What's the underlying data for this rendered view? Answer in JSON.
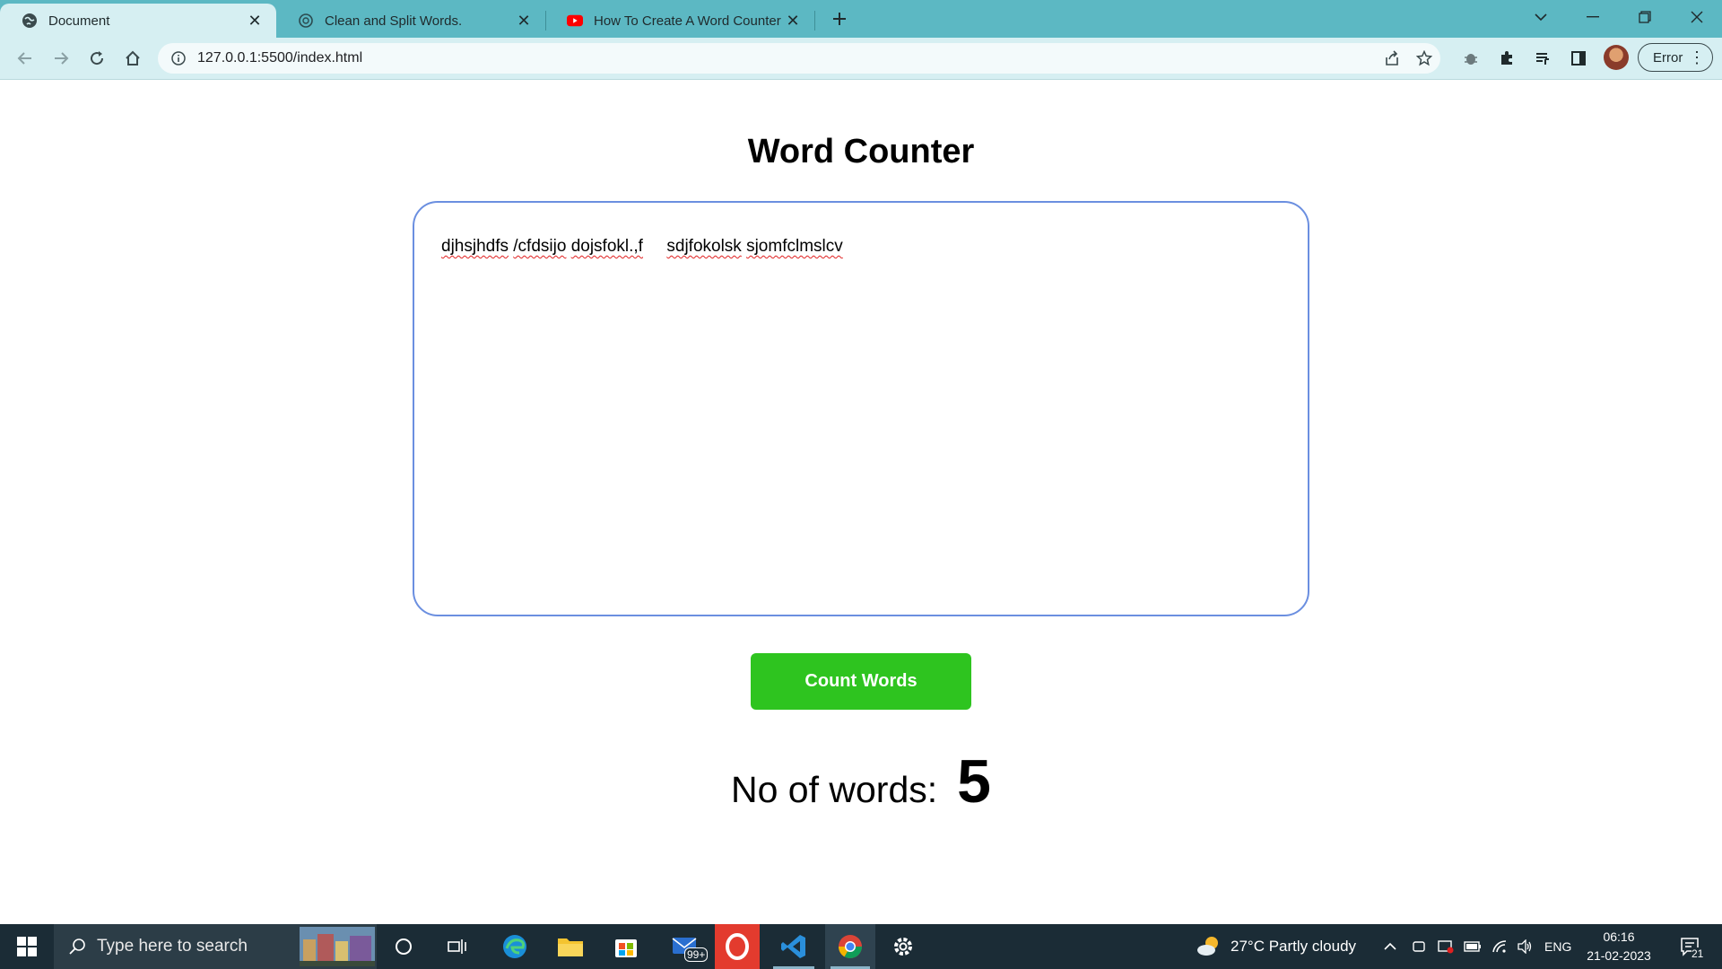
{
  "browser": {
    "tabs": [
      {
        "title": "Document",
        "favicon": "globe-icon",
        "active": true
      },
      {
        "title": "Clean and Split Words.",
        "favicon": "openai-icon",
        "active": false
      },
      {
        "title": "How To Create A Word Counter U",
        "favicon": "youtube-icon",
        "active": false
      }
    ],
    "address": "127.0.0.1:5500/index.html",
    "profile_button": "Error"
  },
  "page": {
    "title": "Word Counter",
    "textarea_words": [
      "djhsjhdfs",
      "/cfdsijo",
      "dojsfokl.,f",
      "sdjfokolsk",
      "sjomfclmslcv"
    ],
    "button_label": "Count Words",
    "result_label": "No of words:",
    "result_value": "5"
  },
  "taskbar": {
    "search_placeholder": "Type here to search",
    "mail_badge": "99+",
    "weather": "27°C  Partly cloudy",
    "language": "ENG",
    "time": "06:16",
    "date": "21-02-2023",
    "notification_count": "21"
  },
  "colors": {
    "tabstrip": "#5cb8c3",
    "toolbar": "#d6eff2",
    "button": "#2ec41f",
    "textarea_border": "#6b8fe0",
    "taskbar": "#1b2c36"
  }
}
